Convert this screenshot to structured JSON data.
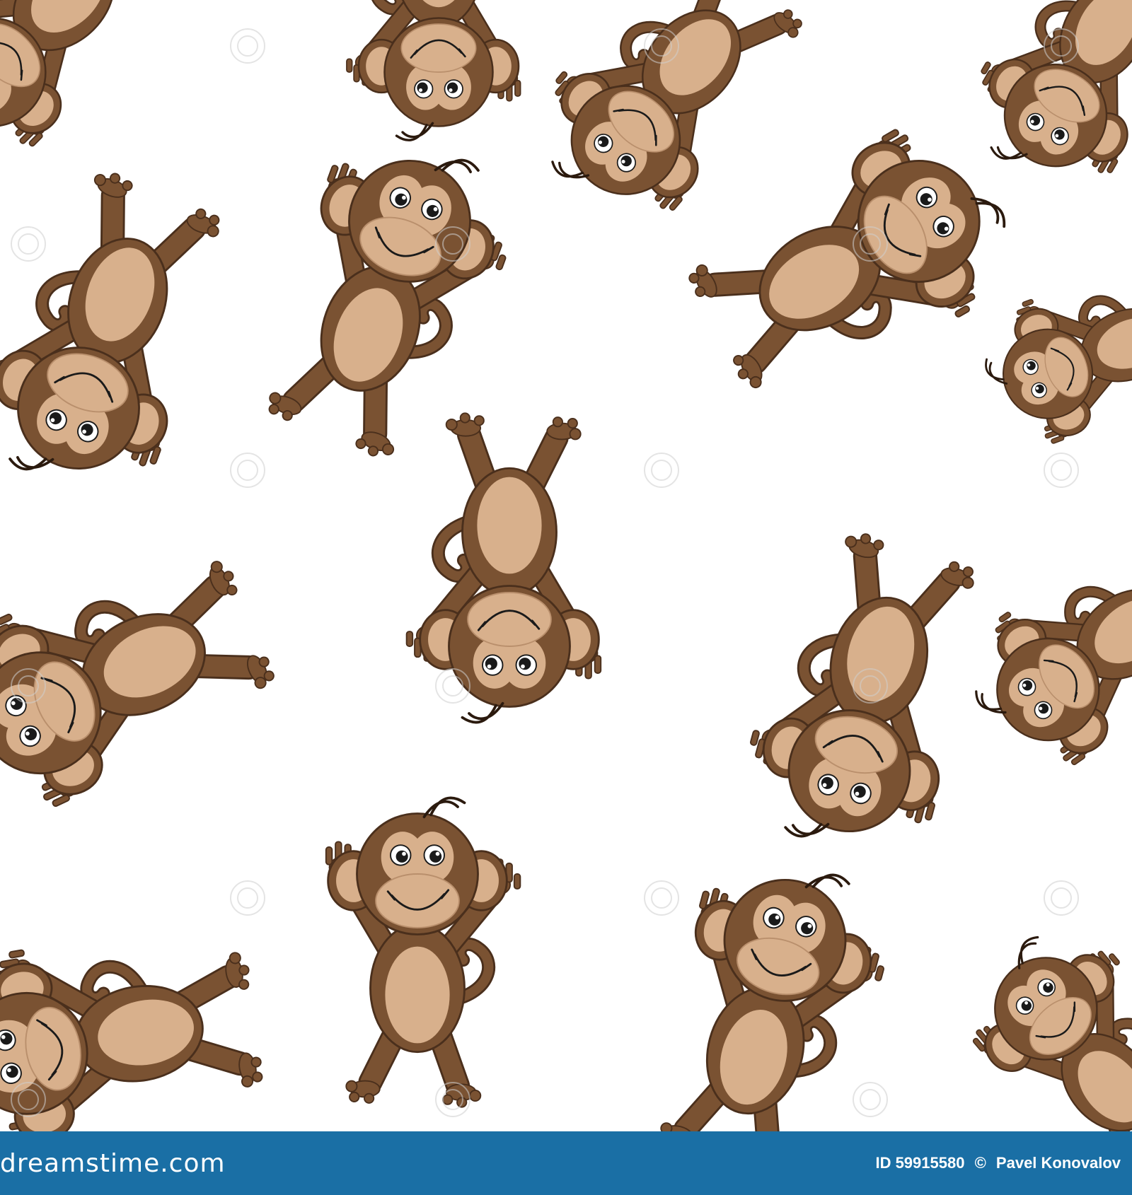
{
  "image": {
    "subject": "seamless-monkey-pattern",
    "colors": {
      "background": "#ffffff",
      "fur": "#7a5232",
      "fur_outline": "#4a2f1c",
      "skin": "#d8b08c",
      "ear_inner": "#c9a07e",
      "eye_white": "#ffffff",
      "pupil": "#1a1a1a",
      "footer": "#1a6fa5",
      "footer_text": "#ffffff"
    }
  },
  "footer": {
    "logo_text": "dreamstime.com",
    "id_label": "ID 59915580",
    "copyright": "©",
    "author": "Pavel Konovalov"
  }
}
